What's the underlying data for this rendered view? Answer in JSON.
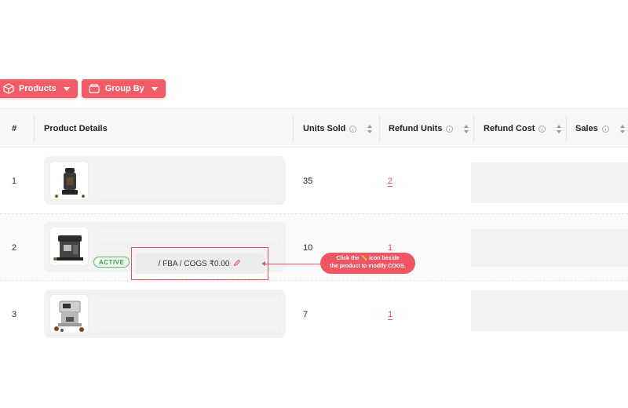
{
  "toolbar": {
    "products_label": "Products",
    "products_icon": "package-icon",
    "groupby_label": "Group By",
    "groupby_icon": "layers-icon",
    "accent": "#f25c66"
  },
  "table": {
    "headers": {
      "index": "#",
      "product": "Product Details",
      "units_sold": "Units Sold",
      "refund_units": "Refund Units",
      "refund_cost": "Refund Cost",
      "sales": "Sales"
    },
    "rows": [
      {
        "index": "1",
        "units_sold": "35",
        "refund_units": "2",
        "thumb_icon": "coffee-grinder-icon"
      },
      {
        "index": "2",
        "units_sold": "10",
        "refund_units": "1",
        "thumb_icon": "espresso-machine-icon",
        "status": "ACTIVE",
        "fulfillment": "/ FBA / COGS ₹0.00",
        "edit_icon": "pencil-icon"
      },
      {
        "index": "3",
        "units_sold": "7",
        "refund_units": "1",
        "thumb_icon": "coffee-machine-icon"
      }
    ]
  },
  "callout": {
    "line1_pre": "Click the",
    "line1_icon": "✏️",
    "line1_post": "icon beside",
    "line2": "the product to modify COGS.",
    "color": "#ef5563"
  }
}
